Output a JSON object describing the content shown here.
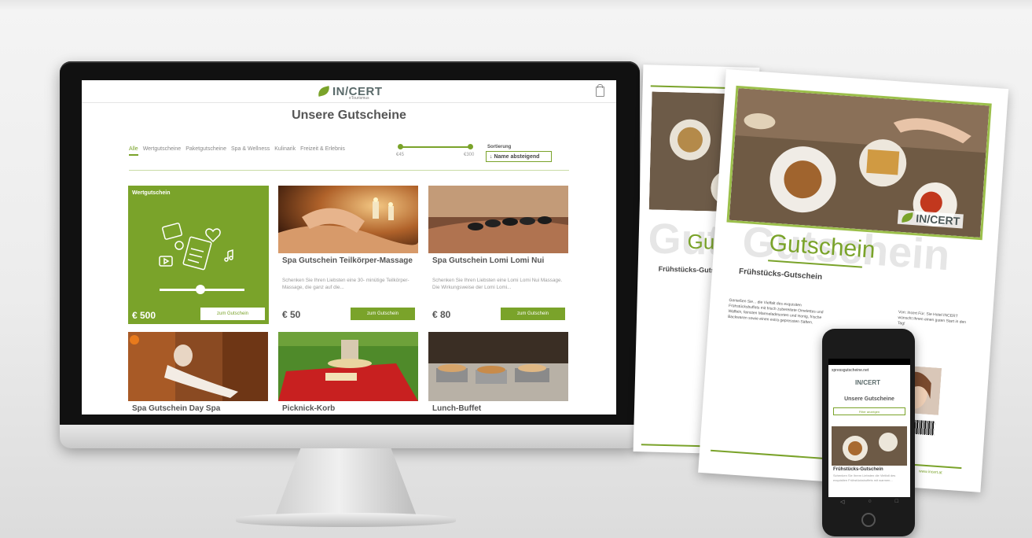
{
  "site": {
    "brand": "IN/CERT",
    "brand_sub": "eTourismus",
    "page_title": "Unsere Gutscheine",
    "filters": [
      "Alle",
      "Wertgutscheine",
      "Paketgutscheine",
      "Spa & Wellness",
      "Kulinarik",
      "Freizeit & Erlebnis"
    ],
    "price_min": "€45",
    "price_max": "€300",
    "sort_label": "Sortierung",
    "sort_value": "↓ Name absteigend",
    "accent": "#7aa32a"
  },
  "featured": {
    "label": "Wertgutschein",
    "price": "€ 500",
    "button": "zum Gutschein"
  },
  "cards": [
    {
      "title": "Spa Gutschein Teilkörper-Massage",
      "desc": "Schenken Sie Ihren Liebsten eine 30- minütige Teilkörper-Massage, die ganz auf die...",
      "price": "€ 50",
      "button": "zum Gutschein"
    },
    {
      "title": "Spa Gutschein Lomi Lomi Nui",
      "desc": "Schenken Sie Ihren Liebsten eine Lomi Lomi Nui Massage. Die Wirkungsweise der Lomi Lomi...",
      "price": "€ 80",
      "button": "zum Gutschein"
    }
  ],
  "bottom_titles": [
    "Spa Gutschein Day Spa",
    "Picknick-Korb",
    "Lunch-Buffet"
  ],
  "paper": {
    "word": "Gutschein",
    "subtitle": "Frühstücks-Gutschein",
    "back_word": "Guts",
    "back_sub": "Frühstücks-Gutsch",
    "body_left": "Genießen Sie... die Vielfalt des exquisiten Frühstücksbuffets mit frisch zubereitete Omelettes und Waffeln, feinsten Marmeladesorten und Honig, frische Backwaren sowie einen extra gepressten Säften.",
    "body_right": "Von: Incert Für: Sie Hotel INCERT wünscht Ihnen einen guten Start in den Tag!",
    "footer": "www.incert.at",
    "brand": "IN/CERT"
  },
  "phone": {
    "url": "xpressgutscheine.net",
    "brand": "IN/CERT",
    "title": "Unsere Gutscheine",
    "filter": "Filter anzeigen",
    "card_title": "Frühstücks-Gutschein",
    "card_desc": "Schenken Sie Ihrem Liebsten die Vielfalt des exquisiten Frühstücksbuffets mit warmen..."
  }
}
